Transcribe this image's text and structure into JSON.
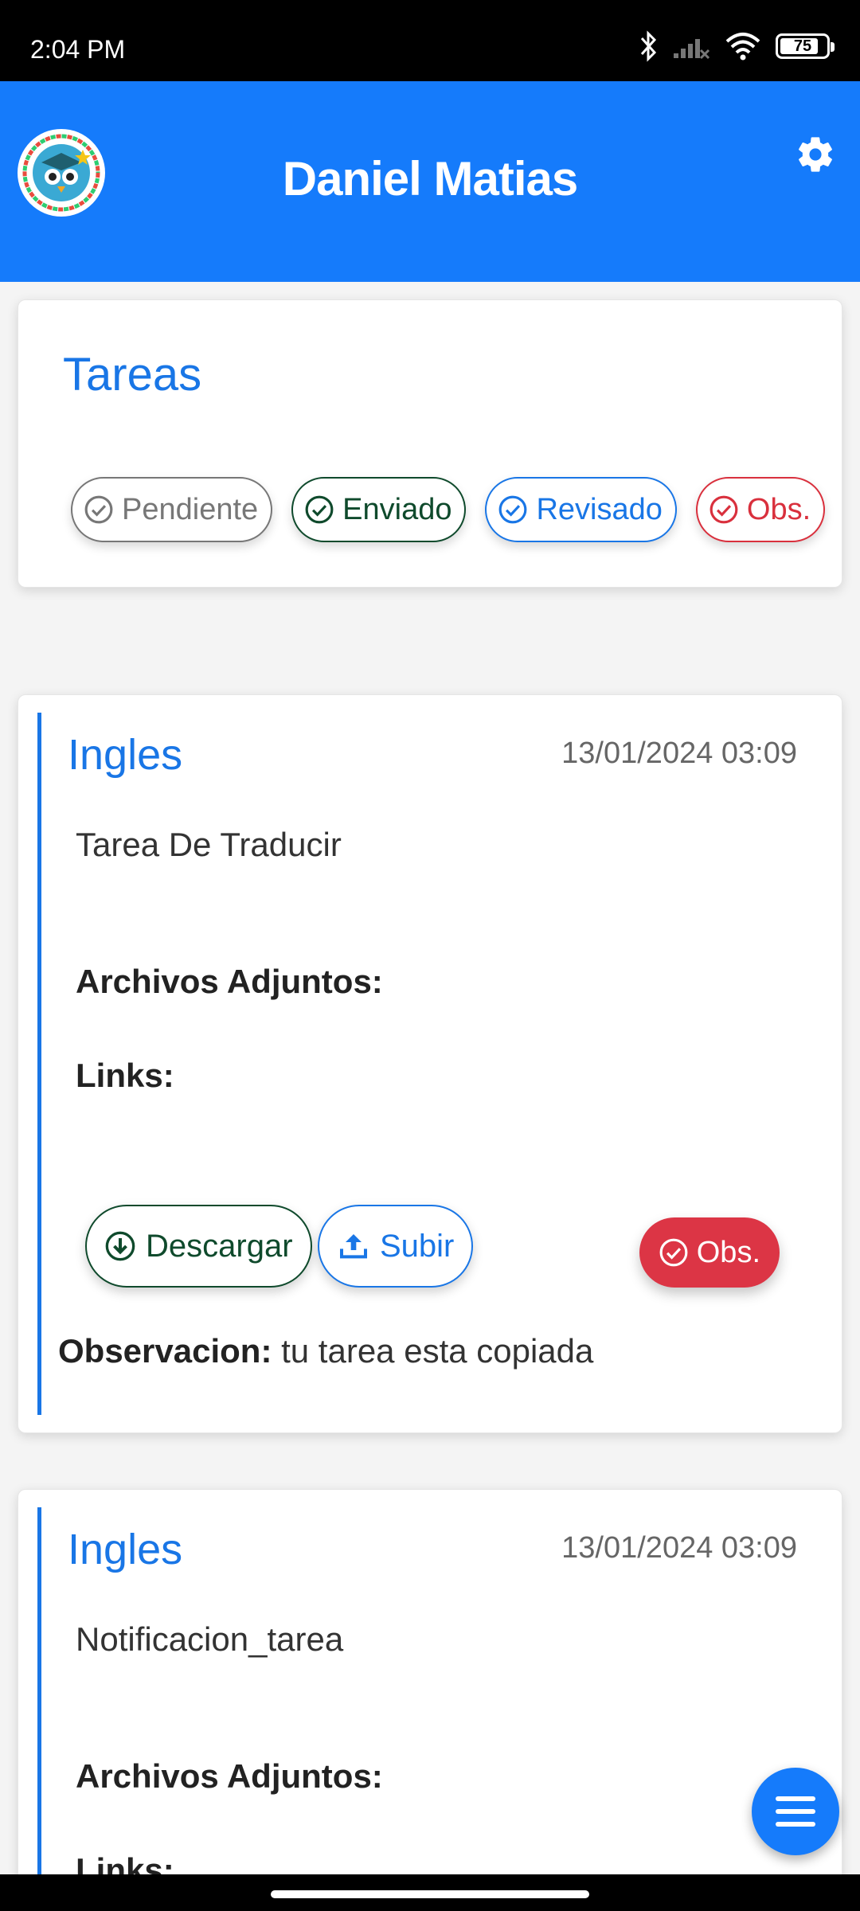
{
  "status_bar": {
    "time": "2:04 PM",
    "battery_level": "75",
    "icons": [
      "bluetooth-icon",
      "signal-icon",
      "wifi-icon",
      "battery-icon"
    ]
  },
  "header": {
    "title": "Daniel Matias",
    "logo": "owl-graduate-logo",
    "settings_icon": "gear-icon",
    "color": "#157bfb"
  },
  "filters": {
    "title": "Tareas",
    "chips": [
      {
        "label": "Pendiente",
        "color": "#777777"
      },
      {
        "label": "Enviado",
        "color": "#0f4a2c"
      },
      {
        "label": "Revisado",
        "color": "#1976e6"
      },
      {
        "label": "Obs.",
        "color": "#d9303d"
      }
    ]
  },
  "tasks": [
    {
      "subject": "Ingles",
      "date": "13/01/2024 03:09",
      "description": "Tarea De Traducir",
      "attachments_label": "Archivos Adjuntos:",
      "links_label": "Links:",
      "download_label": "Descargar",
      "upload_label": "Subir",
      "status_label": "Obs.",
      "observation_label": "Observacion:",
      "observation_text": "tu tarea esta copiada"
    },
    {
      "subject": "Ingles",
      "date": "13/01/2024 03:09",
      "description": "Notificacion_tarea",
      "attachments_label": "Archivos Adjuntos:",
      "links_label": "Links:"
    }
  ],
  "fab": {
    "icon": "menu-icon"
  }
}
